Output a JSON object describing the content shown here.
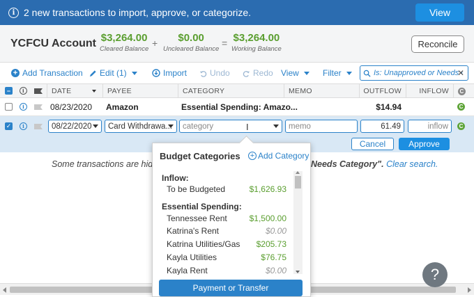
{
  "banner": {
    "message": "2 new transactions to import, approve, or categorize.",
    "view_label": "View"
  },
  "account": {
    "name": "YCFCU Account",
    "cleared": {
      "amount": "$3,264.00",
      "label": "Cleared Balance"
    },
    "uncleared": {
      "amount": "$0.00",
      "label": "Uncleared Balance"
    },
    "working": {
      "amount": "$3,264.00",
      "label": "Working Balance"
    },
    "plus": "+",
    "equals": "=",
    "reconcile_label": "Reconcile"
  },
  "toolbar": {
    "add_transaction": "Add Transaction",
    "edit": "Edit (1)",
    "import": "Import",
    "undo": "Undo",
    "redo": "Redo",
    "view": "View",
    "filter": "Filter",
    "search_text": "Is: Unapproved or Needs Ca"
  },
  "table": {
    "headers": {
      "date": "DATE",
      "payee": "PAYEE",
      "category": "CATEGORY",
      "memo": "MEMO",
      "outflow": "OUTFLOW",
      "inflow": "INFLOW"
    },
    "row1": {
      "date": "08/23/2020",
      "payee": "Amazon",
      "category": "Essential Spending: Amazo...",
      "outflow": "$14.94"
    },
    "row2": {
      "date": "08/22/2020",
      "payee": "Card Withdrawa...",
      "category_placeholder": "category",
      "memo_placeholder": "memo",
      "outflow": "61.49",
      "inflow_placeholder": "inflow"
    },
    "cancel_label": "Cancel",
    "approve_label": "Approve"
  },
  "notice": {
    "left": "Some transactions are hido",
    "right_bold": "Needs Category\".",
    "right_link": "Clear search."
  },
  "popup": {
    "title": "Budget Categories",
    "add_label": "Add Category",
    "groups": [
      {
        "name": "Inflow:",
        "items": [
          {
            "name": "To be Budgeted",
            "amount": "$1,626.93"
          }
        ]
      },
      {
        "name": "Essential Spending:",
        "items": [
          {
            "name": "Tennessee Rent",
            "amount": "$1,500.00"
          },
          {
            "name": "Katrina's Rent",
            "amount": "$0.00"
          },
          {
            "name": "Katrina Utilities/Gas",
            "amount": "$205.73"
          },
          {
            "name": "Kayla Utilities",
            "amount": "$76.75"
          },
          {
            "name": "Kayla Rent",
            "amount": "$0.00"
          }
        ]
      }
    ],
    "payment_label": "Payment or Transfer"
  },
  "help_label": "?",
  "colors": {
    "banner": "#2b6cb0",
    "accent": "#1d8fe1",
    "positive": "#5a9e2f",
    "link": "#2b82c9"
  },
  "icons": [
    "info-icon",
    "plus-circle-icon",
    "pencil-icon",
    "import-icon",
    "undo-icon",
    "redo-icon",
    "search-icon",
    "close-icon",
    "flag-icon",
    "cleared-icon",
    "chevron-down-icon",
    "help-icon"
  ]
}
